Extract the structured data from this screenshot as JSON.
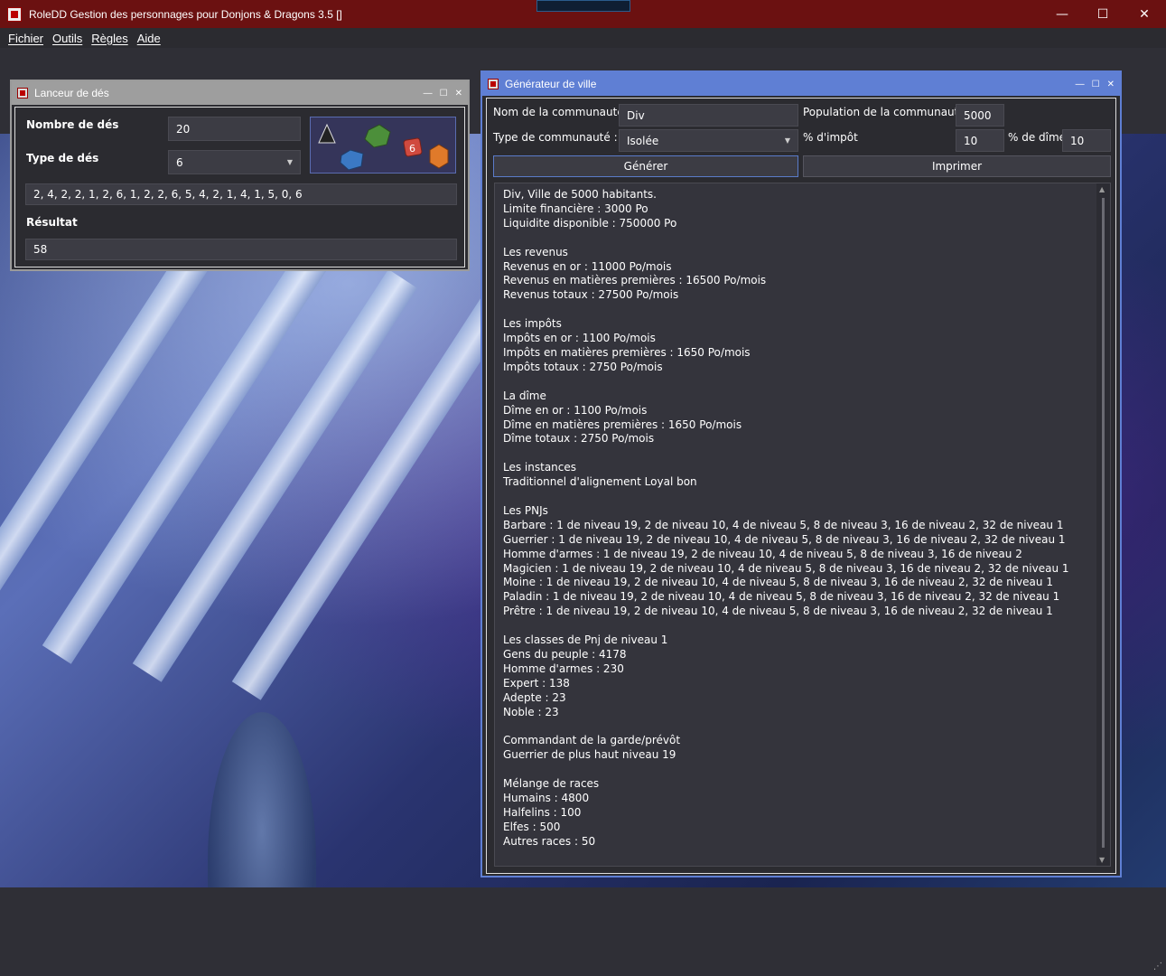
{
  "app": {
    "title": "RoleDD Gestion des personnages pour Donjons & Dragons 3.5 []",
    "window_buttons": {
      "minimize": "—",
      "maximize": "☐",
      "close": "✕"
    }
  },
  "menu": [
    "Fichier",
    "Outils",
    "Règles",
    "Aide"
  ],
  "dice_window": {
    "title": "Lanceur de dés",
    "count_label": "Nombre de dés",
    "count_value": "20",
    "type_label": "Type de dés",
    "type_value": "6",
    "rolls": "2, 4, 2, 2, 1, 2, 6, 1, 2, 2, 6, 5, 4, 2, 1, 4, 1, 5, 0, 6",
    "result_label": "Résultat",
    "result_value": "58",
    "dice_icons": [
      "d4-black",
      "d10-green",
      "d8-blue",
      "d6-red",
      "d20-orange"
    ],
    "dice_colors": [
      "#222222",
      "#4c8f3a",
      "#3b79c4",
      "#d04a3f",
      "#e07a2a"
    ],
    "red_die_number": "6"
  },
  "town_window": {
    "title": "Générateur de ville",
    "name_label": "Nom de la communauté :",
    "name_value": "Div",
    "population_label": "Population de la communauté :",
    "population_value": "5000",
    "type_label": "Type de communauté :",
    "type_value": "Isolée",
    "tax_label": "% d'impôt",
    "tax_value": "10",
    "tithe_label": "% de dîme",
    "tithe_value": "10",
    "generate_button": "Générer",
    "print_button": "Imprimer",
    "output": "Div, Ville de 5000 habitants.\nLimite financière : 3000 Po\nLiquidite disponible : 750000 Po\n\nLes revenus\nRevenus en or : 11000 Po/mois\nRevenus en matières premières : 16500 Po/mois\nRevenus totaux : 27500 Po/mois\n\nLes impôts\nImpôts en or : 1100 Po/mois\nImpôts en matières premières : 1650 Po/mois\nImpôts totaux : 2750 Po/mois\n\nLa dîme\nDîme en or : 1100 Po/mois\nDîme en matières premières : 1650 Po/mois\nDîme totaux : 2750 Po/mois\n\nLes instances\nTraditionnel d'alignement Loyal bon\n\nLes PNJs\nBarbare : 1 de niveau 19, 2 de niveau 10, 4 de niveau 5, 8 de niveau 3, 16 de niveau 2, 32 de niveau 1\nGuerrier : 1 de niveau 19, 2 de niveau 10, 4 de niveau 5, 8 de niveau 3, 16 de niveau 2, 32 de niveau 1\nHomme d'armes : 1 de niveau 19, 2 de niveau 10, 4 de niveau 5, 8 de niveau 3, 16 de niveau 2\nMagicien : 1 de niveau 19, 2 de niveau 10, 4 de niveau 5, 8 de niveau 3, 16 de niveau 2, 32 de niveau 1\nMoine : 1 de niveau 19, 2 de niveau 10, 4 de niveau 5, 8 de niveau 3, 16 de niveau 2, 32 de niveau 1\nPaladin : 1 de niveau 19, 2 de niveau 10, 4 de niveau 5, 8 de niveau 3, 16 de niveau 2, 32 de niveau 1\nPrêtre : 1 de niveau 19, 2 de niveau 10, 4 de niveau 5, 8 de niveau 3, 16 de niveau 2, 32 de niveau 1\n\nLes classes de Pnj de niveau 1\nGens du peuple : 4178\nHomme d'armes : 230\nExpert : 138\nAdepte : 23\nNoble : 23\n\nCommandant de la garde/prévôt\nGuerrier de plus haut niveau 19\n\nMélange de races\nHumains : 4800\nHalfelins : 100\nElfes : 500\nAutres races : 50"
  },
  "colors": {
    "titlebar": "#6b1111",
    "dice_border": "#9a9a9a",
    "town_border": "#5f7fd4",
    "focus_border": "#5a7bc9"
  }
}
